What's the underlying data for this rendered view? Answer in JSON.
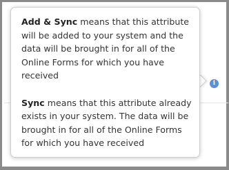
{
  "tooltip": {
    "add_sync": {
      "term": "Add & Sync",
      "text": " means that this attribute will be added to your system and the data will be brought in for all of the Online Forms for which you have received"
    },
    "sync": {
      "term": "Sync",
      "text": " means that this attribute already exists in your system. The data will be brought in for all of the Online Forms for which you have received"
    }
  },
  "info_icon": {
    "glyph": "i",
    "icon": "info-icon",
    "color": "#5b8fd6"
  }
}
